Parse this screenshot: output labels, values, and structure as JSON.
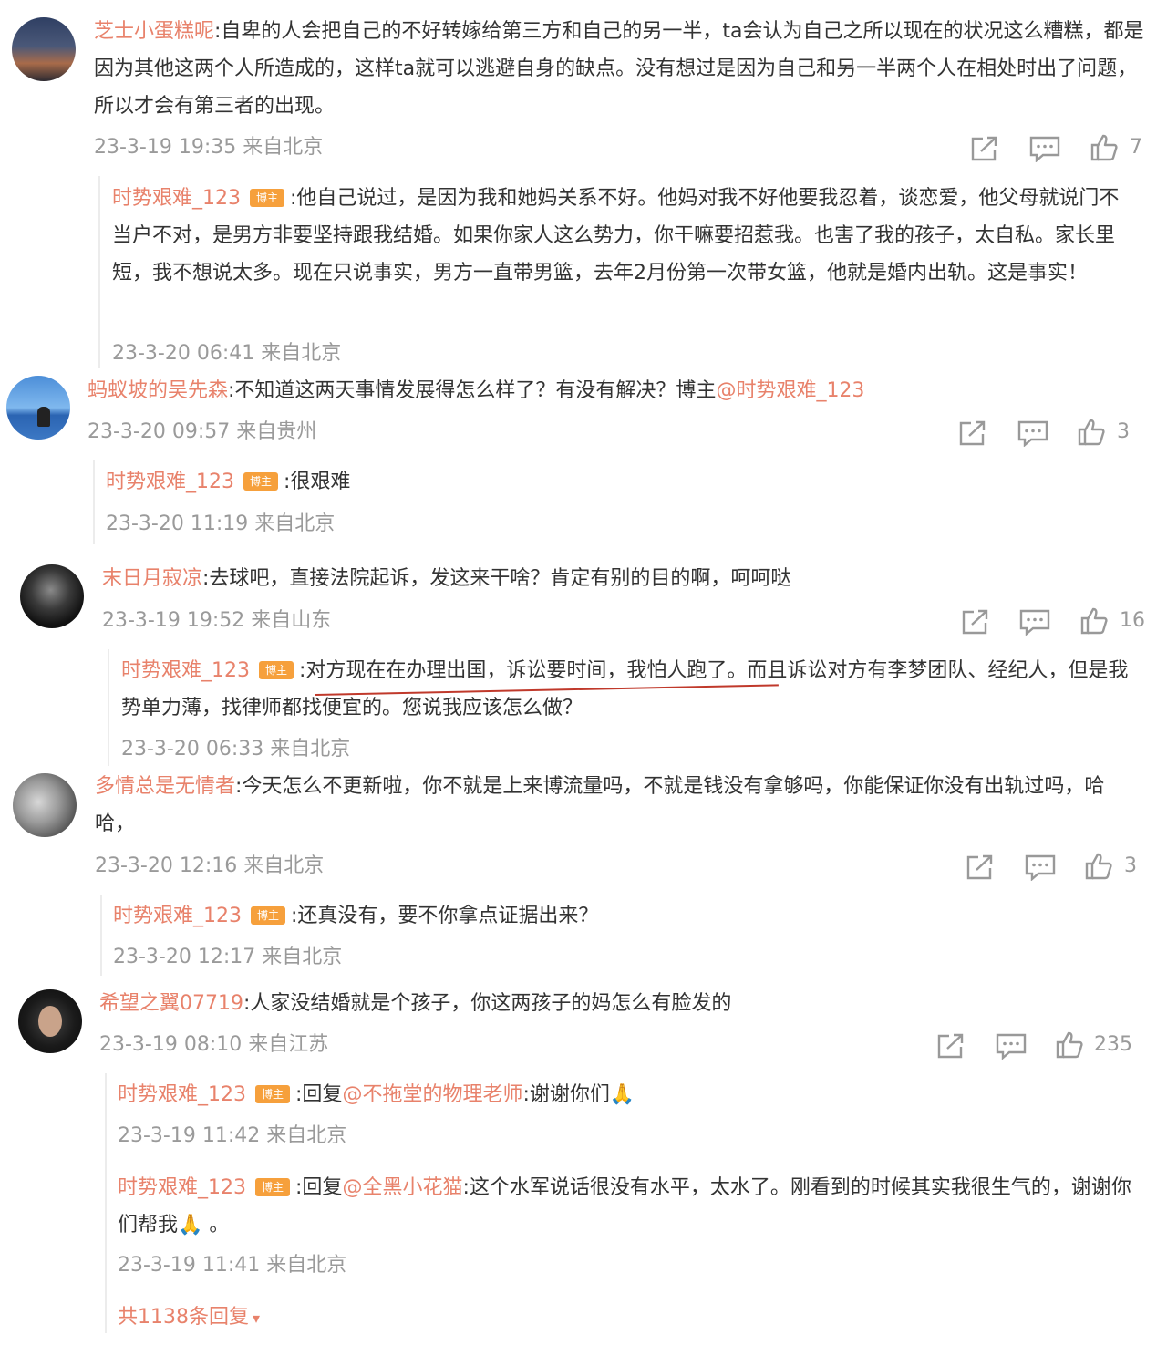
{
  "comments": [
    {
      "author": "芝士小蛋糕呢",
      "text": ":自卑的人会把自己的不好转嫁给第三方和自己的另一半，ta会认为自己之所以现在的状况这么糟糕，都是因为其他这两个人所造成的，这样ta就可以逃避自身的缺点。没有想过是因为自己和另一半两个人在相处时出了问题，所以才会有第三者的出现。",
      "meta": "23-3-19 19:35 来自北京",
      "likes": "7",
      "replies": [
        {
          "author": "时势艰难_123",
          "badge": "博主",
          "text": ":他自己说过，是因为我和她妈关系不好。他妈对我不好他要我忍着，谈恋爱，他父母就说门不当户不对，是男方非要坚持跟我结婚。如果你家人这么势力，你干嘛要招惹我。也害了我的孩子，太自私。家长里短，我不想说太多。现在只说事实，男方一直带男篮，去年2月份第一次带女篮，他就是婚内出轨。这是事实！",
          "meta": "23-3-20 06:41 来自北京"
        }
      ]
    },
    {
      "author": "蚂蚁坡的吴先森",
      "text": ":不知道这两天事情发展得怎么样了？有没有解决？博主",
      "mention": "@时势艰难_123",
      "meta": "23-3-20 09:57 来自贵州",
      "likes": "3",
      "replies": [
        {
          "author": "时势艰难_123",
          "badge": "博主",
          "text": ":很艰难",
          "meta": "23-3-20 11:19 来自北京"
        }
      ]
    },
    {
      "author": "末日月寂凉",
      "text": ":去球吧，直接法院起诉，发这来干啥？肯定有别的目的啊，呵呵哒",
      "meta": "23-3-19 19:52 来自山东",
      "likes": "16",
      "replies": [
        {
          "author": "时势艰难_123",
          "badge": "博主",
          "text": ":对方现在在办理出国，诉讼要时间，我怕人跑了。而且诉讼对方有李梦团队、经纪人，但是我势单力薄，找律师都找便宜的。您说我应该怎么做？",
          "meta": "23-3-20 06:33 来自北京"
        }
      ]
    },
    {
      "author": "多情总是无情者",
      "text": ":今天怎么不更新啦，你不就是上来博流量吗，不就是钱没有拿够吗，你能保证你没有出轨过吗，哈哈，",
      "meta": "23-3-20 12:16 来自北京",
      "likes": "3",
      "replies": [
        {
          "author": "时势艰难_123",
          "badge": "博主",
          "text": ":还真没有，要不你拿点证据出来？",
          "meta": "23-3-20 12:17 来自北京"
        }
      ]
    },
    {
      "author": "希望之翼07719",
      "text": ":人家没结婚就是个孩子，你这两孩子的妈怎么有脸发的",
      "meta": "23-3-19 08:10 来自江苏",
      "likes": "235",
      "replies": [
        {
          "author": "时势艰难_123",
          "badge": "博主",
          "prefix": ":回复",
          "mention": "@不拖堂的物理老师",
          "text": ":谢谢你们🙏",
          "meta": "23-3-19 11:42 来自北京"
        },
        {
          "author": "时势艰难_123",
          "badge": "博主",
          "prefix": ":回复",
          "mention": "@全黑小花猫",
          "text": ":这个水军说话很没有水平，太水了。刚看到的时候其实我很生气的，谢谢你们帮我🙏 。",
          "meta": "23-3-19 11:41 来自北京"
        }
      ]
    }
  ],
  "more_replies": "共1138条回复",
  "more_replies_arrow": "▾",
  "icons": [
    "share-icon",
    "comment-icon",
    "like-icon",
    "chevron-down-icon"
  ],
  "colors": {
    "name": "#e8826b",
    "badge": "#f6a03c",
    "meta": "#9a9a9a",
    "text": "#333333",
    "underline": "#c0392b"
  }
}
